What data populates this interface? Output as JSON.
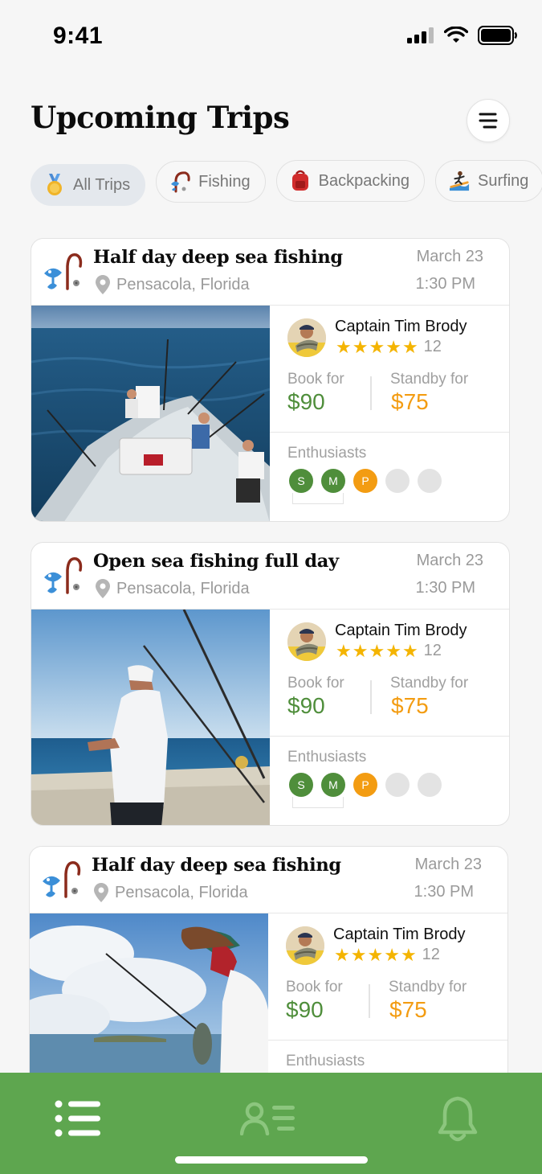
{
  "status_bar": {
    "time": "9:41"
  },
  "header": {
    "title": "Upcoming Trips"
  },
  "filters": [
    {
      "label": "All Trips",
      "icon": "medal-icon",
      "active": true
    },
    {
      "label": "Fishing",
      "icon": "fishing-pole-icon",
      "active": false
    },
    {
      "label": "Backpacking",
      "icon": "backpack-icon",
      "active": false
    },
    {
      "label": "Surfing",
      "icon": "surfer-icon",
      "active": false
    }
  ],
  "trips": [
    {
      "title": "Half day deep sea fishing",
      "location": "Pensacola, Florida",
      "date": "March 23",
      "time": "1:30 PM",
      "captain": "Captain Tim Brody",
      "rating_count": "12",
      "book_label": "Book for",
      "book_price": "$90",
      "standby_label": "Standby for",
      "standby_price": "$75",
      "enthusiasts_label": "Enthusiasts",
      "enthusiasts": [
        "S",
        "M",
        "P",
        "",
        ""
      ]
    },
    {
      "title": "Open sea fishing full day",
      "location": "Pensacola, Florida",
      "date": "March 23",
      "time": "1:30 PM",
      "captain": "Captain Tim Brody",
      "rating_count": "12",
      "book_label": "Book for",
      "book_price": "$90",
      "standby_label": "Standby for",
      "standby_price": "$75",
      "enthusiasts_label": "Enthusiasts",
      "enthusiasts": [
        "S",
        "M",
        "P",
        "",
        ""
      ]
    },
    {
      "title": "Half day deep sea fishing",
      "location": "Pensacola, Florida",
      "date": "March 23",
      "time": "1:30 PM",
      "captain": "Captain Tim Brody",
      "rating_count": "12",
      "book_label": "Book for",
      "book_price": "$90",
      "standby_label": "Standby for",
      "standby_price": "$75",
      "enthusiasts_label": "Enthusiasts"
    }
  ],
  "tabbar": {
    "tabs": [
      "list-icon",
      "contacts-icon",
      "bell-icon"
    ],
    "color": "#5ea64f"
  },
  "colors": {
    "accent_green": "#4f8e3b",
    "standby_orange": "#f39c12",
    "star": "#f4b400"
  }
}
